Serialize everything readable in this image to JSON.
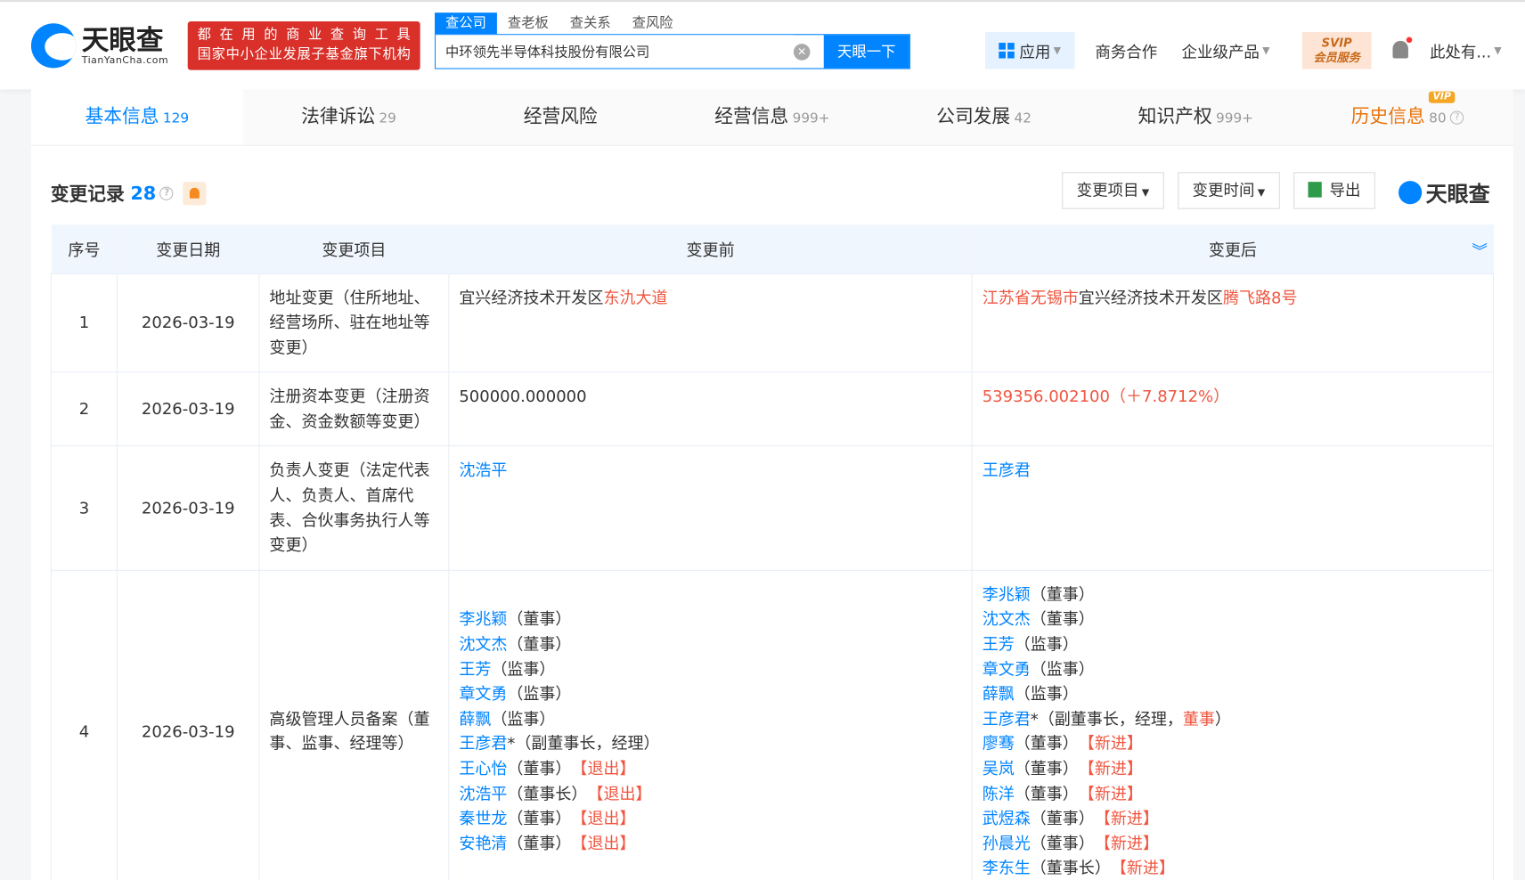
{
  "header": {
    "logo_cn": "天眼查",
    "logo_en": "TianYanCha.com",
    "banner_line1": "都在用的商业查询工具",
    "banner_line2": "国家中小企业发展子基金旗下机构",
    "search_tabs": [
      "查公司",
      "查老板",
      "查关系",
      "查风险"
    ],
    "search_value": "中环领先半导体科技股份有限公司",
    "search_button": "天眼一下",
    "nav": {
      "apps": "应用",
      "business": "商务合作",
      "enterprise": "企业级产品",
      "svip_line1": "SVIP",
      "svip_line2": "会员服务",
      "user": "此处有..."
    }
  },
  "tabs": [
    {
      "label": "基本信息",
      "count": "129"
    },
    {
      "label": "法律诉讼",
      "count": "29"
    },
    {
      "label": "经营风险",
      "count": ""
    },
    {
      "label": "经营信息",
      "count": "999+"
    },
    {
      "label": "公司发展",
      "count": "42"
    },
    {
      "label": "知识产权",
      "count": "999+"
    },
    {
      "label": "历史信息",
      "count": "80",
      "badge": "VIP"
    }
  ],
  "section": {
    "title": "变更记录",
    "count": "28",
    "filter_item": "变更项目",
    "filter_time": "变更时间",
    "export": "导出",
    "brand": "天眼查"
  },
  "table": {
    "headers": [
      "序号",
      "变更日期",
      "变更项目",
      "变更前",
      "变更后"
    ],
    "rows": [
      {
        "no": "1",
        "date": "2026-03-19",
        "item": "地址变更（住所地址、经营场所、驻在地址等变更）",
        "before": [
          [
            {
              "t": "宜兴经济技术开发区"
            },
            {
              "t": "东氿大道",
              "c": "r"
            }
          ]
        ],
        "after": [
          [
            {
              "t": "江苏省无锡市",
              "c": "r"
            },
            {
              "t": "宜兴经济技术开发区"
            },
            {
              "t": "腾飞路8号",
              "c": "r"
            }
          ]
        ]
      },
      {
        "no": "2",
        "date": "2026-03-19",
        "item": "注册资本变更（注册资金、资金数额等变更）",
        "before": [
          [
            {
              "t": "500000.000000"
            }
          ]
        ],
        "after": [
          [
            {
              "t": "539356.002100（＋7.8712%）",
              "c": "r"
            }
          ]
        ]
      },
      {
        "no": "3",
        "date": "2026-03-19",
        "item": "负责人变更（法定代表人、负责人、首席代表、合伙事务执行人等变更）",
        "before": [
          [
            {
              "t": "沈浩平",
              "c": "b"
            }
          ]
        ],
        "after": [
          [
            {
              "t": "王彦君",
              "c": "b"
            }
          ]
        ]
      },
      {
        "no": "4",
        "date": "2026-03-19",
        "item": "高级管理人员备案（董事、监事、经理等）",
        "before": [
          [
            {
              "t": "李兆颖",
              "c": "b"
            },
            {
              "t": "（董事）"
            }
          ],
          [
            {
              "t": "沈文杰",
              "c": "b"
            },
            {
              "t": "（董事）"
            }
          ],
          [
            {
              "t": "王芳",
              "c": "b"
            },
            {
              "t": "（监事）"
            }
          ],
          [
            {
              "t": "章文勇",
              "c": "b"
            },
            {
              "t": "（监事）"
            }
          ],
          [
            {
              "t": "薛飘",
              "c": "b"
            },
            {
              "t": "（监事）"
            }
          ],
          [
            {
              "t": "王彦君",
              "c": "b"
            },
            {
              "t": "*（副董事长，经理）"
            }
          ],
          [
            {
              "t": "王心怡",
              "c": "b"
            },
            {
              "t": "（董事）　"
            },
            {
              "t": "【退出】",
              "c": "r"
            }
          ],
          [
            {
              "t": "沈浩平",
              "c": "b"
            },
            {
              "t": "（董事长）　"
            },
            {
              "t": "【退出】",
              "c": "r"
            }
          ],
          [
            {
              "t": "秦世龙",
              "c": "b"
            },
            {
              "t": "（董事）　"
            },
            {
              "t": "【退出】",
              "c": "r"
            }
          ],
          [
            {
              "t": "安艳清",
              "c": "b"
            },
            {
              "t": "（董事）　"
            },
            {
              "t": "【退出】",
              "c": "r"
            }
          ]
        ],
        "after": [
          [
            {
              "t": "李兆颖",
              "c": "b"
            },
            {
              "t": "（董事）"
            }
          ],
          [
            {
              "t": "沈文杰",
              "c": "b"
            },
            {
              "t": "（董事）"
            }
          ],
          [
            {
              "t": "王芳",
              "c": "b"
            },
            {
              "t": "（监事）"
            }
          ],
          [
            {
              "t": "章文勇",
              "c": "b"
            },
            {
              "t": "（监事）"
            }
          ],
          [
            {
              "t": "薛飘",
              "c": "b"
            },
            {
              "t": "（监事）"
            }
          ],
          [
            {
              "t": "王彦君",
              "c": "b"
            },
            {
              "t": "*（副董事长，经理，"
            },
            {
              "t": "董事",
              "c": "r"
            },
            {
              "t": "）"
            }
          ],
          [
            {
              "t": "廖骞",
              "c": "b"
            },
            {
              "t": "（董事）　"
            },
            {
              "t": "【新进】",
              "c": "r"
            }
          ],
          [
            {
              "t": "吴岚",
              "c": "b"
            },
            {
              "t": "（董事）　"
            },
            {
              "t": "【新进】",
              "c": "r"
            }
          ],
          [
            {
              "t": "陈洋",
              "c": "b"
            },
            {
              "t": "（董事）　"
            },
            {
              "t": "【新进】",
              "c": "r"
            }
          ],
          [
            {
              "t": "武煜森",
              "c": "b"
            },
            {
              "t": "（董事）　"
            },
            {
              "t": "【新进】",
              "c": "r"
            }
          ],
          [
            {
              "t": "孙晨光",
              "c": "b"
            },
            {
              "t": "（董事）　"
            },
            {
              "t": "【新进】",
              "c": "r"
            }
          ],
          [
            {
              "t": "李东生",
              "c": "b"
            },
            {
              "t": "（董事长）　"
            },
            {
              "t": "【新进】",
              "c": "r"
            }
          ]
        ]
      }
    ]
  },
  "colors": {
    "accent": "#0084ff",
    "highlight": "#f0553f",
    "banner": "#d9302a"
  }
}
